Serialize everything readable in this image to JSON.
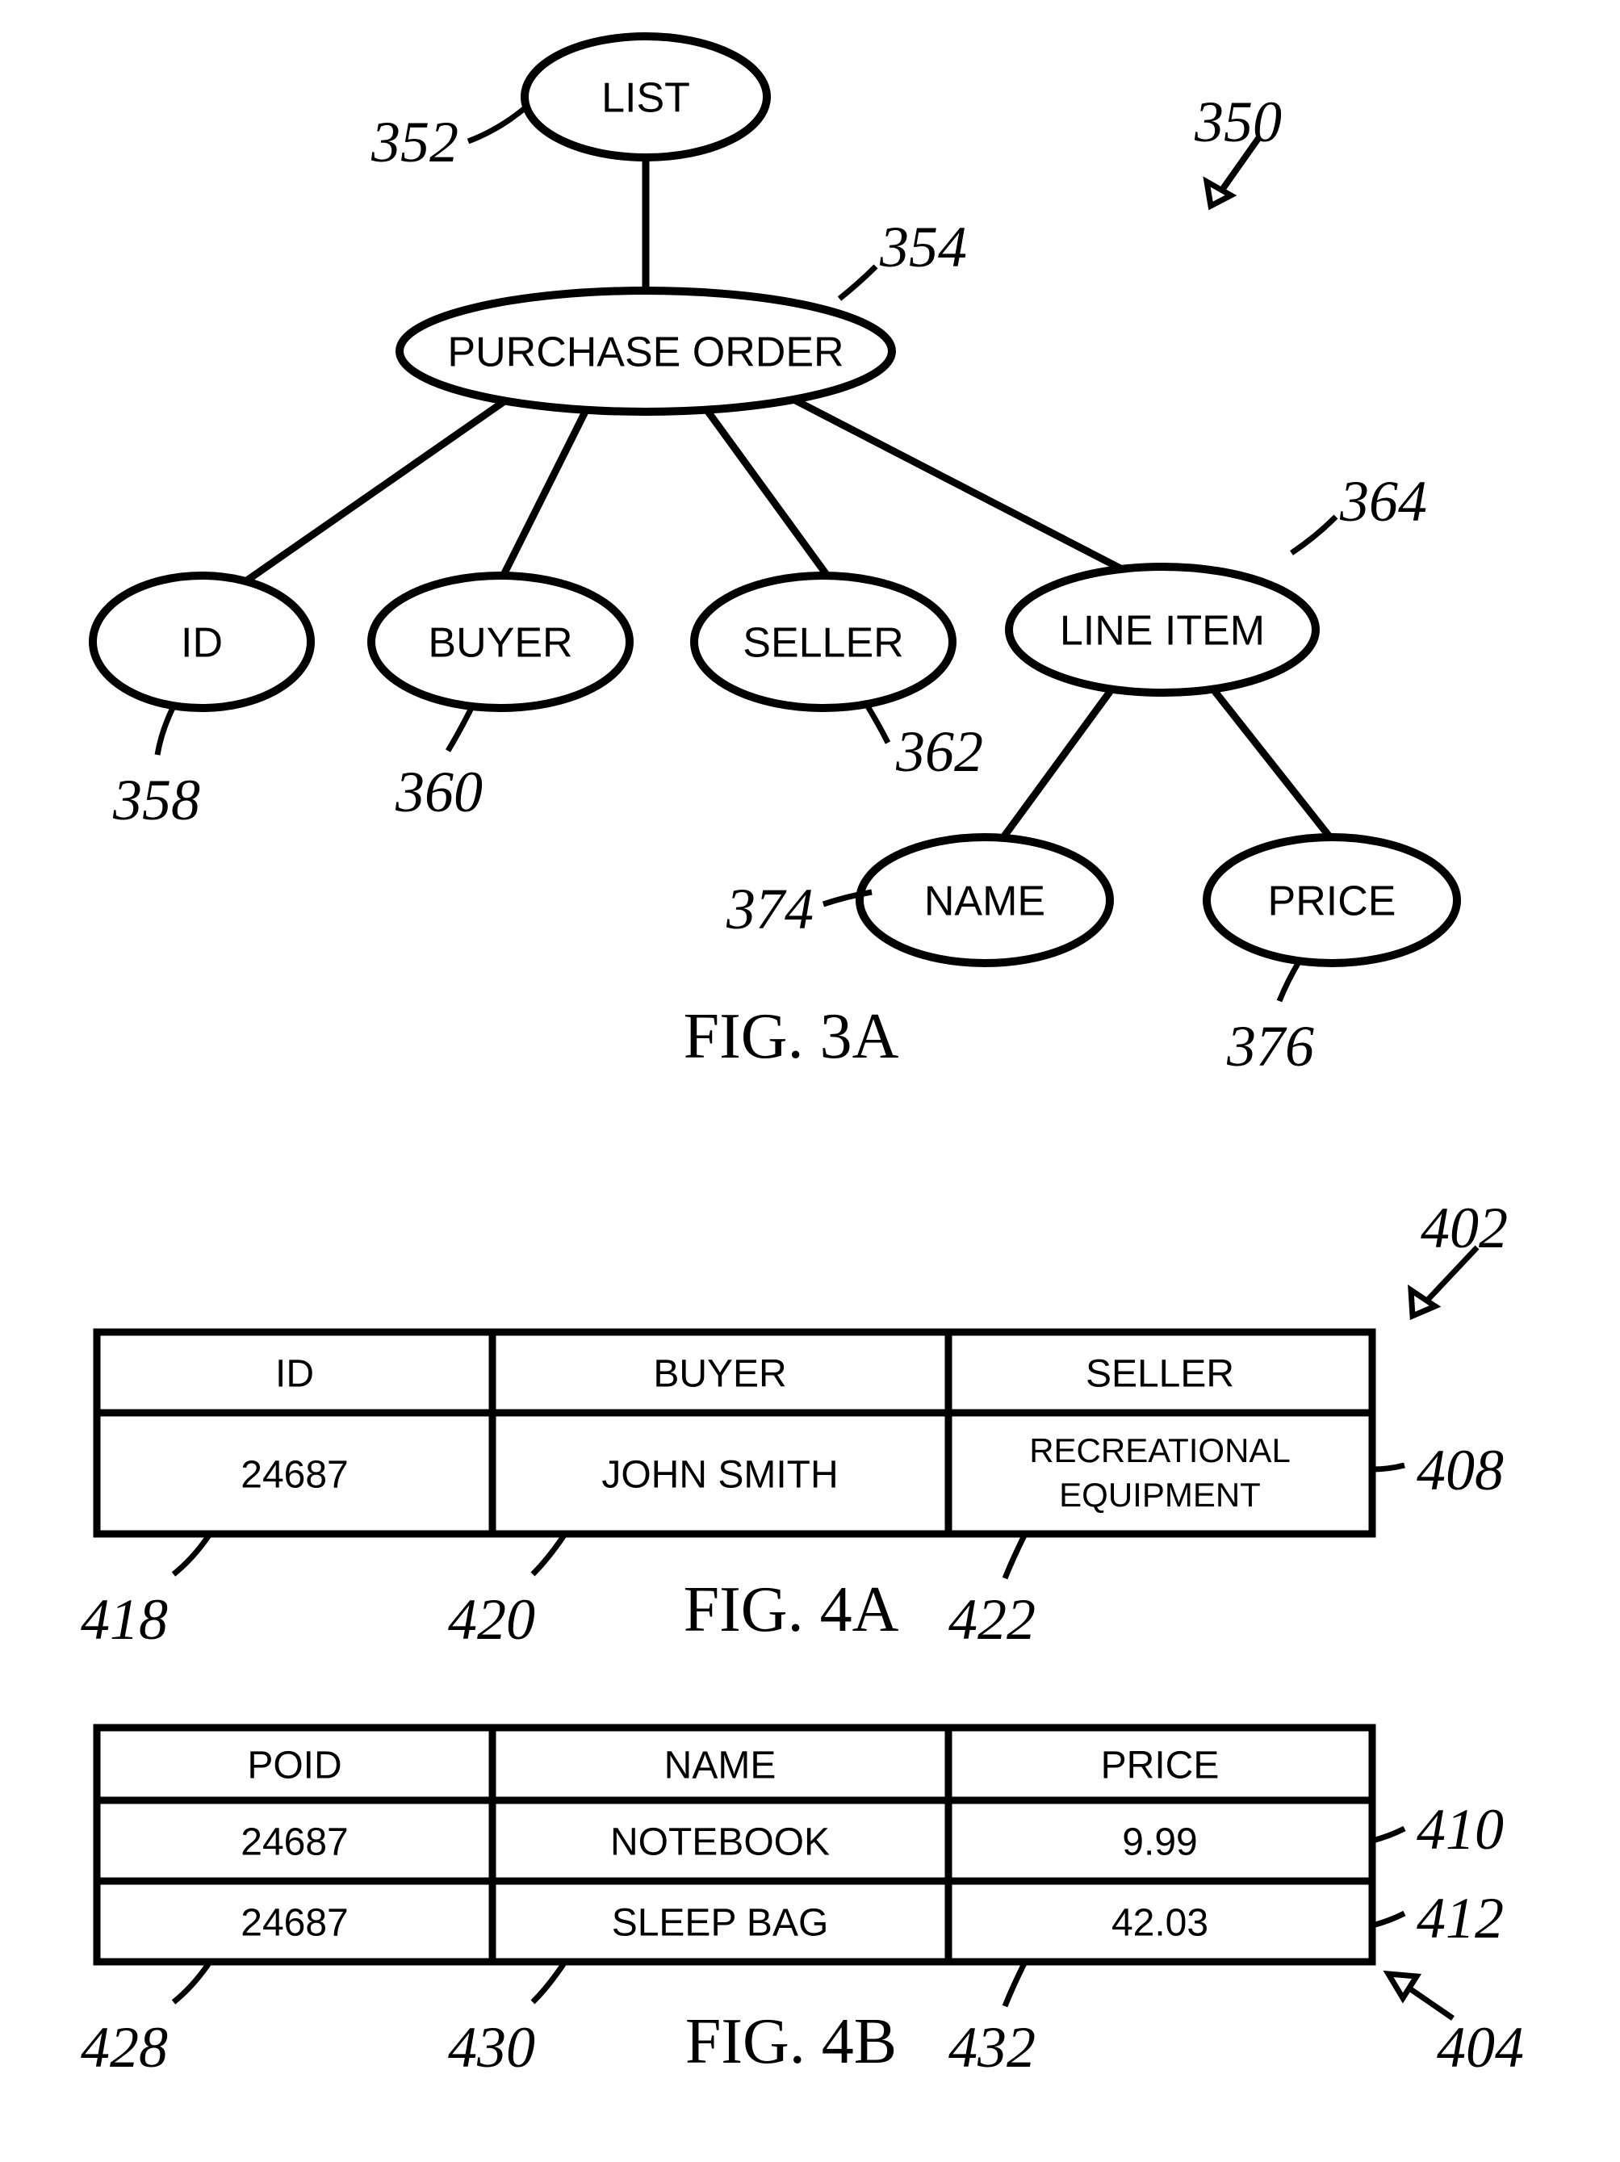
{
  "fig3a": {
    "caption": "FIG. 3A",
    "nodes": {
      "list": "LIST",
      "po": "PURCHASE ORDER",
      "id": "ID",
      "buyer": "BUYER",
      "seller": "SELLER",
      "lineitem": "LINE ITEM",
      "name": "NAME",
      "price": "PRICE"
    },
    "refs": {
      "r350": "350",
      "r352": "352",
      "r354": "354",
      "r358": "358",
      "r360": "360",
      "r362": "362",
      "r364": "364",
      "r374": "374",
      "r376": "376"
    }
  },
  "fig4a": {
    "caption": "FIG. 4A",
    "headers": {
      "c1": "ID",
      "c2": "BUYER",
      "c3": "SELLER"
    },
    "row1": {
      "c1": "24687",
      "c2": "JOHN SMITH",
      "c3a": "RECREATIONAL",
      "c3b": "EQUIPMENT"
    },
    "refs": {
      "r402": "402",
      "r408": "408",
      "r418": "418",
      "r420": "420",
      "r422": "422"
    }
  },
  "fig4b": {
    "caption": "FIG. 4B",
    "headers": {
      "c1": "POID",
      "c2": "NAME",
      "c3": "PRICE"
    },
    "row1": {
      "c1": "24687",
      "c2": "NOTEBOOK",
      "c3": "9.99"
    },
    "row2": {
      "c1": "24687",
      "c2": "SLEEP BAG",
      "c3": "42.03"
    },
    "refs": {
      "r404": "404",
      "r410": "410",
      "r412": "412",
      "r428": "428",
      "r430": "430",
      "r432": "432"
    }
  }
}
